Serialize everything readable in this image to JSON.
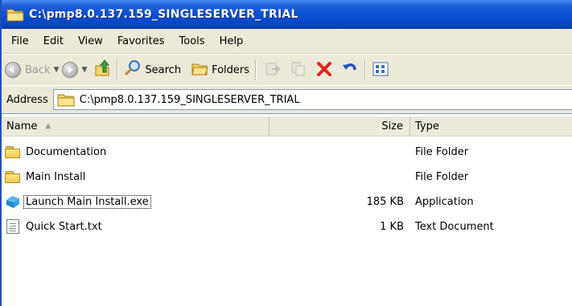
{
  "window": {
    "title": "C:\\pmp8.0.137.159_SINGLESERVER_TRIAL"
  },
  "menu": [
    "File",
    "Edit",
    "View",
    "Favorites",
    "Tools",
    "Help"
  ],
  "toolbar": {
    "back_label": "Back",
    "search_label": "Search",
    "folders_label": "Folders"
  },
  "address": {
    "label": "Address",
    "value": "C:\\pmp8.0.137.159_SINGLESERVER_TRIAL"
  },
  "columns": {
    "name": "Name",
    "size": "Size",
    "type": "Type"
  },
  "files": [
    {
      "name": "Documentation",
      "size": "",
      "type": "File Folder",
      "icon": "folder-icon"
    },
    {
      "name": "Main Install",
      "size": "",
      "type": "File Folder",
      "icon": "folder-icon"
    },
    {
      "name": "Launch Main Install.exe",
      "size": "185 KB",
      "type": "Application",
      "icon": "application-icon"
    },
    {
      "name": "Quick Start.txt",
      "size": "1 KB",
      "type": "Text Document",
      "icon": "text-file-icon"
    }
  ],
  "colors": {
    "titlebar": "#0a4fd6",
    "chrome": "#ece9d8",
    "delete_red": "#e0261b"
  }
}
